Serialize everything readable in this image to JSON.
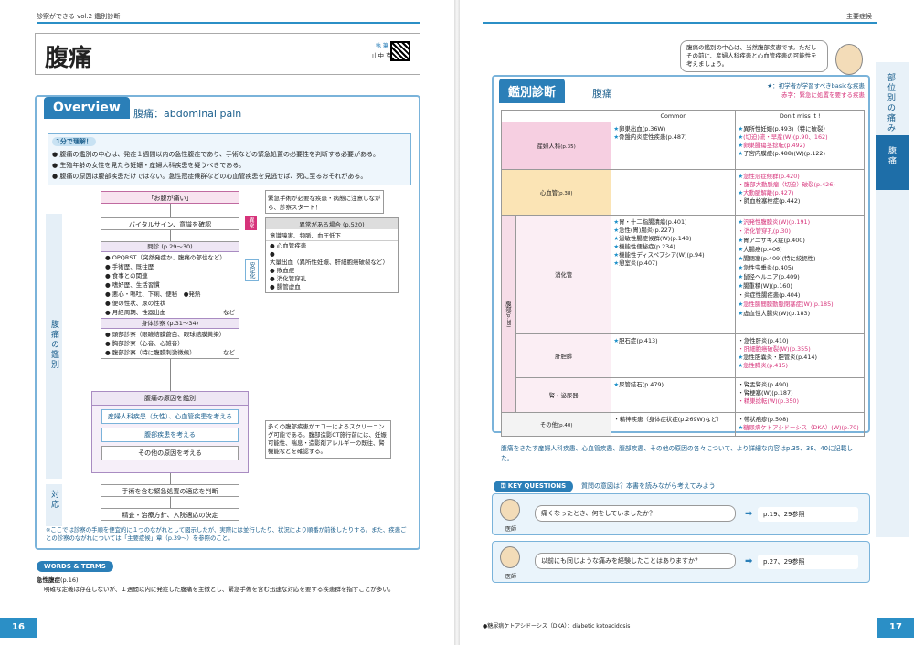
{
  "left": {
    "header": "診察ができる vol.2 鑑別診断",
    "title": "腹痛",
    "author_role": "執 筆",
    "author_name": "山中 克郎",
    "overview_label": "Overview",
    "overview_title": "腹痛：abdominal pain",
    "one_min_label": "1分で理解！",
    "summary": [
      "腹痛の鑑別の中心は、発症１週間以内の急性腹症であり、手術などの緊急処置の必要性を判断する必要がある。",
      "生殖年齢の女性を見たら妊娠・産婦人科疾患を疑うべきである。",
      "腹痛の原因は腹部疾患だけではない。急性冠症候群などの心血管疾患を見逃せば、死に至るおそれがある。"
    ],
    "flow": {
      "start": "「お腹が痛い」",
      "note1": "緊急手術が必要な疾患・病態に注意しながら、診察スタート！",
      "vital": "バイタルサイン、意識を確認",
      "abnormal_tag": "異常",
      "stable_tag": "安定化",
      "abn_title": "異常がある場合",
      "abn_ref": "(p.520)",
      "abn_sub": "意識障害、頻脈、血圧低下",
      "abn_items": [
        "心血管疾患",
        "大量出血（異所性妊娠、肝細胞癌破裂など）",
        "敗血症",
        "消化管穿孔",
        "腸管虚血"
      ],
      "interview_title": "問診",
      "interview_ref": "(p.29〜30)",
      "interview_items": [
        "OPQRST（突然発症か、腹痛の部位など）",
        "手術歴、既往歴",
        "食事との関連",
        "嗜好歴、生活習慣",
        "悪心・嘔吐、下痢、便秘　●発熱",
        "便の性状、尿の性状",
        "月経周期、性器出血"
      ],
      "nado": "など",
      "exam_title": "身体診察",
      "exam_ref": "(p.31〜34)",
      "exam_items": [
        "頭部診察（眼瞼結膜蒼白、眼球結膜黄染）",
        "胸部診察（心音、心雑音）",
        "腹部診察（特に腹膜刺激徴候）"
      ],
      "diff_title": "腹痛の原因を鑑別",
      "diff1": "産婦人科疾患（女性）、心血管疾患を考える",
      "diff2": "腹部疾患を考える",
      "diff3": "その他の原因を考える",
      "note2": "多くの腹部疾患がエコーによるスクリーニング可能である。腹部造影CT施行前には、妊娠可能性、喘息・造影剤アレルギーの既往、腎機能などを確認する。",
      "act1": "手術を含む緊急処置の適応を判断",
      "act2": "精査・治療方針、入院適応の決定",
      "side1": "腹痛の鑑別",
      "side2": "対応"
    },
    "footnote": "※ここでは診察の手順を便宜的に１つのながれとして図示したが、実際には並行したり、状況により順番が前後したりする。また、疾患ごとの診察のながれについては「主要症候」章（p.39〜）を参照のこと。",
    "words_label": "WORDS & TERMS",
    "words_term": "急性腹症",
    "words_ref": "(p.16)",
    "words_text": "明確な定義は存在しないが、１週間以内に発症した腹痛を主徴とし、緊急手術を含む迅速な対応を要する疾患群を指すことが多い。",
    "page": "16"
  },
  "right": {
    "header": "主要症候",
    "doc_bubble": "腹痛の鑑別の中心は、当然腹部疾患です。ただしその前に、産婦人科疾患と心血管疾患の可能性を考えましょう。",
    "kanbetsu": "鑑別診断",
    "kanbetsu_sub": "腹痛",
    "legend1": "★：初学者が学習すべきbasicな疾患",
    "legend2": "赤字：緊急に処置を要する疾患",
    "col_common": "Common",
    "col_dontmiss": "Don't miss it !",
    "rows": [
      {
        "cat": "産婦人科",
        "ref": "(p.35)",
        "common": [
          "卵巣出血(p.36W)",
          "骨盤内炎症性疾患(p.487)"
        ],
        "dm": [
          "異所性妊娠(p.493)（特に破裂）",
          "(切迫)流・早産(W)(p.90、162)",
          "卵巣腫瘍茎捻転(p.492)",
          "子宮内膜症(p.488)(W)(p.122)"
        ]
      },
      {
        "cat": "心血管",
        "ref": "(p.38)",
        "common": [],
        "dm": [
          "急性冠症候群(p.420)",
          "腹部大動脈瘤（切迫）破裂(p.426)",
          "大動脈解離(p.427)",
          "肺血栓塞栓症(p.442)"
        ]
      },
      {
        "cat": "消化管",
        "ref": "",
        "common": [
          "胃・十二指腸潰瘍(p.401)",
          "急性(胃)腸炎(p.227)",
          "過敏性腸症候群(W)(p.148)",
          "機能性便秘症(p.234)",
          "機能性ディスペプシア(W)(p.94)",
          "憩室炎(p.407)"
        ],
        "dm": [
          "汎発性腹膜炎(W)(p.191)",
          "消化管穿孔(p.30)",
          "胃アニサキス症(p.400)",
          "大腸癌(p.406)",
          "腸閉塞(p.409)(特に絞扼性)",
          "急性虫垂炎(p.405)",
          "鼠径ヘルニア(p.409)",
          "腸重積(W)(p.160)",
          "炎症性腸疾患(p.404)",
          "急性腸間膜動脈閉塞症(W)(p.185)",
          "虚血性大腸炎(W)(p.183)"
        ]
      },
      {
        "cat": "肝胆膵",
        "ref": "",
        "common": [
          "胆石症(p.413)"
        ],
        "dm": [
          "急性肝炎(p.410)",
          "肝細胞癌破裂(W)(p.355)",
          "急性胆嚢炎・胆管炎(p.414)",
          "急性膵炎(p.415)"
        ]
      },
      {
        "cat": "腎・泌尿器",
        "ref": "",
        "common": [
          "尿管結石(p.479)"
        ],
        "dm": [
          "腎盂腎炎(p.490)",
          "腎梗塞(W)(p.187)",
          "精巣捻転(W)(p.350)"
        ]
      },
      {
        "cat": "その他",
        "ref": "(p.40)",
        "common": [
          "精神疾患（身体症状症(p.269W)など）"
        ],
        "dm": [
          "帯状疱疹(p.508)",
          "糖尿病ケトアシドーシス（DKA）(W)(p.70)"
        ]
      }
    ],
    "abd_label": "腹部",
    "abd_ref": "(p.38)",
    "table_note": "腹痛をきたす産婦人科疾患、心血管疾患、腹部疾患、その他の原因の各々について、より詳細な内容はp.35、38、40に記載した。",
    "kq_label": "KEY QUESTIONS",
    "kq_intro": "質問の意図は？本書を読みながら考えてみよう！",
    "kq": [
      {
        "q": "痛くなったとき、何をしていましたか？",
        "ref": "p.19、29参照",
        "who": "医師"
      },
      {
        "q": "以前にも同じような痛みを経験したことはありますか？",
        "ref": "p.27、29参照",
        "who": "医師"
      }
    ],
    "side_label": "部位別の痛み",
    "side_tab": "腹痛",
    "footnote": "●糖尿病ケトアシドーシス（DKA）：diabetic ketoacidosis",
    "page": "17"
  }
}
